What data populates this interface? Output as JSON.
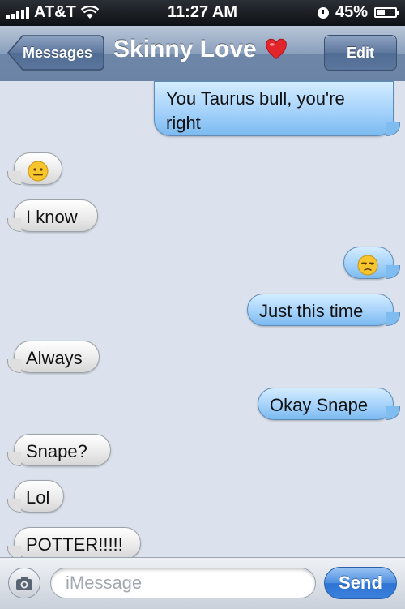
{
  "status_bar": {
    "carrier": "AT&T",
    "time": "11:27 AM",
    "battery": "45%",
    "battery_level": 0.45,
    "signal_icon": "signal-bars-icon",
    "wifi_icon": "wifi-icon",
    "alarm_icon": "clock-icon"
  },
  "nav": {
    "back_label": "Messages",
    "title": "Skinny Love",
    "title_emoji": "heart-icon",
    "edit_label": "Edit"
  },
  "messages": [
    {
      "side": "out",
      "text": "You Taurus bull, you're right"
    },
    {
      "side": "in",
      "emoji": "neutral-face-icon"
    },
    {
      "side": "in",
      "text": "I know"
    },
    {
      "side": "out",
      "emoji": "unamused-face-icon"
    },
    {
      "side": "out",
      "text": "Just this time"
    },
    {
      "side": "in",
      "text": "Always"
    },
    {
      "side": "out",
      "text": "Okay Snape"
    },
    {
      "side": "in",
      "text": "Snape?"
    },
    {
      "side": "in",
      "text": "Lol"
    },
    {
      "side": "in",
      "text": "POTTER!!!!!"
    }
  ],
  "composer": {
    "placeholder": "iMessage",
    "send_label": "Send",
    "camera_icon": "camera-icon"
  },
  "colors": {
    "incoming_bubble": "#e9e9e9",
    "outgoing_bubble": "#a5d2fb",
    "nav_bar": "#6e86a8",
    "send_button": "#2f73d3"
  }
}
